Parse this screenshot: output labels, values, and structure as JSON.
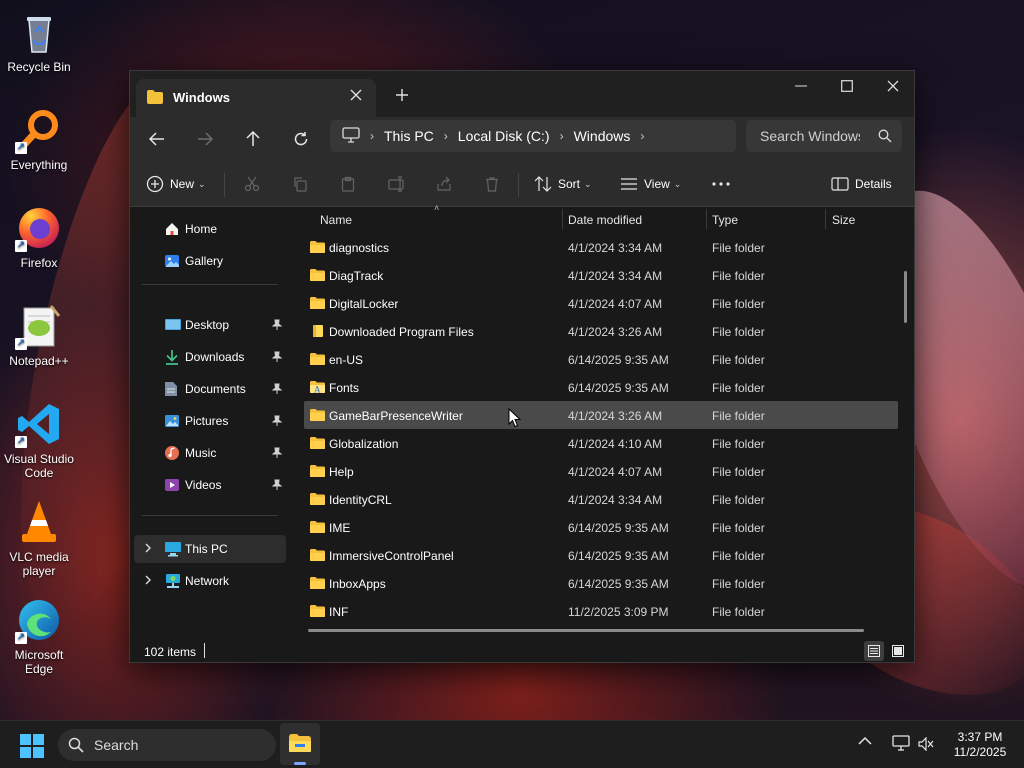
{
  "desktop_icons": [
    {
      "label": "Recycle Bin",
      "icon": "recycle-bin-icon"
    },
    {
      "label": "Everything",
      "icon": "everything-icon"
    },
    {
      "label": "Firefox",
      "icon": "firefox-icon"
    },
    {
      "label": "Notepad++",
      "icon": "notepad-plus-plus-icon"
    },
    {
      "label": "Visual Studio Code",
      "icon": "vscode-icon"
    },
    {
      "label": "VLC media player",
      "icon": "vlc-icon"
    },
    {
      "label": "Microsoft Edge",
      "icon": "edge-icon"
    }
  ],
  "window": {
    "tab_title": "Windows",
    "breadcrumb": [
      "This PC",
      "Local Disk (C:)",
      "Windows"
    ],
    "search_placeholder": "Search Windows"
  },
  "toolbar": {
    "new_label": "New",
    "sort_label": "Sort",
    "view_label": "View",
    "details_label": "Details"
  },
  "sidebar": {
    "top": [
      {
        "label": "Home",
        "icon": "home-icon"
      },
      {
        "label": "Gallery",
        "icon": "gallery-icon"
      }
    ],
    "quick_access": [
      {
        "label": "Desktop",
        "icon": "desktop-folder-icon"
      },
      {
        "label": "Downloads",
        "icon": "downloads-icon"
      },
      {
        "label": "Documents",
        "icon": "documents-icon"
      },
      {
        "label": "Pictures",
        "icon": "pictures-icon"
      },
      {
        "label": "Music",
        "icon": "music-icon"
      },
      {
        "label": "Videos",
        "icon": "videos-icon"
      }
    ],
    "locations": [
      {
        "label": "This PC",
        "icon": "this-pc-icon",
        "selected": true
      },
      {
        "label": "Network",
        "icon": "network-icon",
        "selected": false
      }
    ]
  },
  "columns": {
    "name": "Name",
    "date": "Date modified",
    "type": "Type",
    "size": "Size"
  },
  "files": [
    {
      "name": "diagnostics",
      "date": "4/1/2024 3:34 AM",
      "type": "File folder",
      "icon": "folder-icon"
    },
    {
      "name": "DiagTrack",
      "date": "4/1/2024 3:34 AM",
      "type": "File folder",
      "icon": "folder-icon"
    },
    {
      "name": "DigitalLocker",
      "date": "4/1/2024 4:07 AM",
      "type": "File folder",
      "icon": "folder-icon"
    },
    {
      "name": "Downloaded Program Files",
      "date": "4/1/2024 3:26 AM",
      "type": "File folder",
      "icon": "special-folder-icon"
    },
    {
      "name": "en-US",
      "date": "6/14/2025 9:35 AM",
      "type": "File folder",
      "icon": "folder-icon"
    },
    {
      "name": "Fonts",
      "date": "6/14/2025 9:35 AM",
      "type": "File folder",
      "icon": "fonts-folder-icon"
    },
    {
      "name": "GameBarPresenceWriter",
      "date": "4/1/2024 3:26 AM",
      "type": "File folder",
      "icon": "folder-icon",
      "hovered": true
    },
    {
      "name": "Globalization",
      "date": "4/1/2024 4:10 AM",
      "type": "File folder",
      "icon": "folder-icon"
    },
    {
      "name": "Help",
      "date": "4/1/2024 4:07 AM",
      "type": "File folder",
      "icon": "folder-icon"
    },
    {
      "name": "IdentityCRL",
      "date": "4/1/2024 3:34 AM",
      "type": "File folder",
      "icon": "folder-icon"
    },
    {
      "name": "IME",
      "date": "6/14/2025 9:35 AM",
      "type": "File folder",
      "icon": "folder-icon"
    },
    {
      "name": "ImmersiveControlPanel",
      "date": "6/14/2025 9:35 AM",
      "type": "File folder",
      "icon": "folder-icon"
    },
    {
      "name": "InboxApps",
      "date": "6/14/2025 9:35 AM",
      "type": "File folder",
      "icon": "folder-icon"
    },
    {
      "name": "INF",
      "date": "11/2/2025 3:09 PM",
      "type": "File folder",
      "icon": "folder-icon"
    }
  ],
  "status": {
    "item_count": "102 items"
  },
  "taskbar": {
    "search_label": "Search",
    "time": "3:37 PM",
    "date": "11/2/2025"
  },
  "colors": {
    "folder": "#f3c13a",
    "accent": "#7aa7ff",
    "window_bg": "#191919",
    "toolbar_bg": "#2c2c2c"
  }
}
